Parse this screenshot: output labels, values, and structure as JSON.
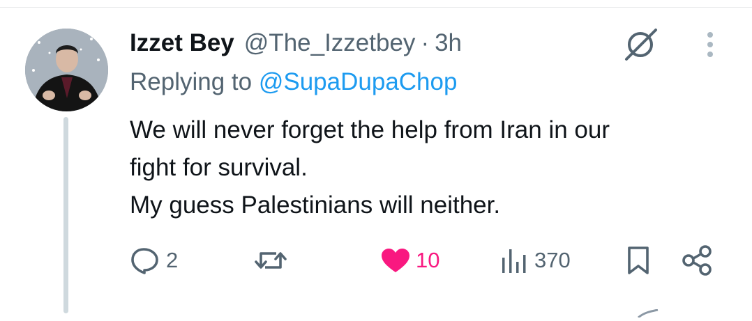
{
  "tweet": {
    "author_name": "Izzet Bey",
    "author_handle": "@The_Izzetbey",
    "separator": "·",
    "time": "3h",
    "reply_prefix": "Replying to",
    "reply_to": "@SupaDupaChop",
    "text_lines": [
      "We will never forget the help from Iran in our",
      "fight for survival.",
      "My guess Palestinians will neither."
    ]
  },
  "actions": {
    "replies": "2",
    "retweets": "",
    "likes": "10",
    "views": "370"
  },
  "icons": {
    "reply": "speech-bubble-icon",
    "retweet": "retweet-arrows-icon",
    "like": "heart-filled-icon",
    "views": "bar-chart-icon",
    "bookmark": "bookmark-icon",
    "share": "share-nodes-icon",
    "grok": "grok-slash-circle-icon",
    "more": "vertical-dots-icon"
  },
  "colors": {
    "text": "#0f1419",
    "secondary": "#536471",
    "link": "#1d9bf0",
    "like": "#f91880",
    "thread_line": "#cfd9de"
  }
}
